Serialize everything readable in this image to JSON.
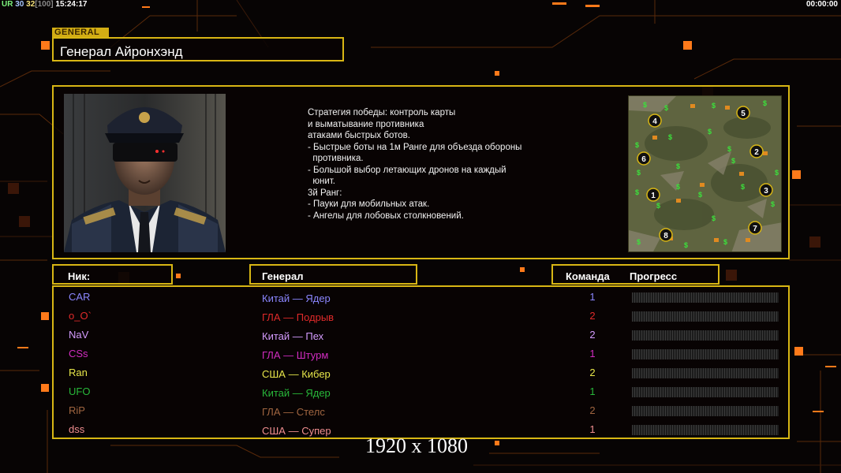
{
  "hud": {
    "ur_label": "UR",
    "fps": "30",
    "fps_cap": "32",
    "fps_max": "[100]",
    "clock": "15:24:17",
    "timer": "00:00:00"
  },
  "general": {
    "tag": "GENERAL",
    "name": "Генерал Айронхэнд"
  },
  "description": {
    "lines": [
      "Стратегия победы: контроль карты",
      "и выматывание противника",
      "атаками быстрых ботов.",
      "",
      "- Быстрые боты на 1м Ранге для объезда обороны",
      "  противника.",
      "- Большой выбор летающих дронов на каждый",
      "  юнит.",
      "",
      "3й Ранг:",
      "- Пауки для мобильных атак.",
      "- Ангелы для лобовых столкновений."
    ]
  },
  "map": {
    "spawn_labels": [
      "1",
      "2",
      "3",
      "4",
      "5",
      "6",
      "7",
      "8"
    ]
  },
  "headers": {
    "nick": "Ник:",
    "general": "Генерал",
    "team": "Команда",
    "progress": "Прогресс"
  },
  "players": [
    {
      "nick": "CAR",
      "general": "Китай — Ядер",
      "team": "1",
      "color": "#8b86ff"
    },
    {
      "nick": "o_O`",
      "general": "ГЛА — Подрыв",
      "team": "2",
      "color": "#e02a2a"
    },
    {
      "nick": "NaV",
      "general": "Китай — Пех",
      "team": "2",
      "color": "#d59cff"
    },
    {
      "nick": "CSs",
      "general": "ГЛА — Штурм",
      "team": "1",
      "color": "#d12cc0"
    },
    {
      "nick": "Ran",
      "general": "США — Кибер",
      "team": "2",
      "color": "#e7e64a"
    },
    {
      "nick": "UFO",
      "general": "Китай — Ядер",
      "team": "1",
      "color": "#28b83a"
    },
    {
      "nick": "RiP",
      "general": "ГЛА — Стелс",
      "team": "2",
      "color": "#a06540"
    },
    {
      "nick": "dss",
      "general": "США — Супер",
      "team": "1",
      "color": "#f08e90"
    }
  ],
  "footer": {
    "resolution": "1920 x 1080"
  },
  "colors": {
    "frame": "#d8b614",
    "accent_orange": "#ff7a00"
  }
}
